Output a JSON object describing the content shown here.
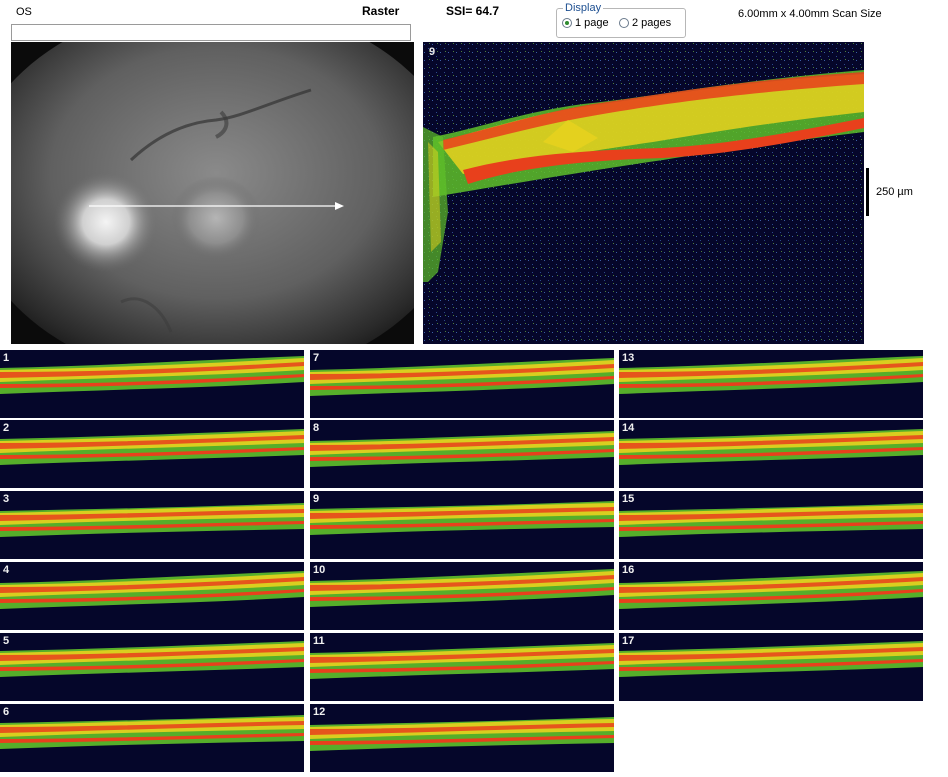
{
  "header": {
    "eye": "OS",
    "scan_type": "Raster",
    "ssi": "SSI= 64.7",
    "scan_size": "6.00mm x 4.00mm Scan Size"
  },
  "display": {
    "legend": "Display",
    "options": [
      {
        "label": "1 page",
        "selected": true
      },
      {
        "label": "2 pages",
        "selected": false
      }
    ]
  },
  "main_scan": {
    "number": "9",
    "scale_label": "250 µm"
  },
  "colors": {
    "retina_red": "#e8401c",
    "retina_yellow": "#e9d21e",
    "retina_green": "#5fc12a",
    "background_navy": "#05062a",
    "radio_checked": "#2e8b2e"
  },
  "thumbnails": [
    {
      "number": "1"
    },
    {
      "number": "2"
    },
    {
      "number": "3"
    },
    {
      "number": "4"
    },
    {
      "number": "5"
    },
    {
      "number": "6"
    },
    {
      "number": "7"
    },
    {
      "number": "8"
    },
    {
      "number": "9"
    },
    {
      "number": "10"
    },
    {
      "number": "11"
    },
    {
      "number": "12"
    },
    {
      "number": "13"
    },
    {
      "number": "14"
    },
    {
      "number": "15"
    },
    {
      "number": "16"
    },
    {
      "number": "17"
    }
  ]
}
